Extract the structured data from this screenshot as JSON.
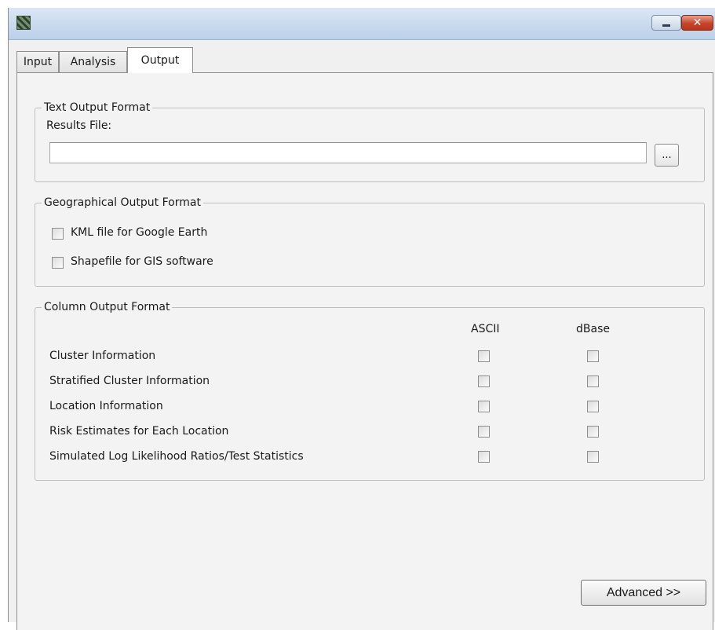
{
  "window": {
    "app_icon": "satscan-app-icon",
    "minimize_icon": "minimize-icon",
    "close_icon": "close-icon",
    "close_glyph": "✕"
  },
  "tabs": [
    {
      "label": "Input",
      "active": false
    },
    {
      "label": "Analysis",
      "active": false
    },
    {
      "label": "Output",
      "active": true
    }
  ],
  "text_output": {
    "title": "Text Output Format",
    "results_label": "Results File:",
    "results_value": "",
    "browse_label": "..."
  },
  "geo_output": {
    "title": "Geographical Output Format",
    "options": [
      {
        "label": "KML file for Google Earth",
        "checked": false
      },
      {
        "label": "Shapefile for GIS software",
        "checked": false
      }
    ]
  },
  "column_output": {
    "title": "Column Output Format",
    "col_ascii": "ASCII",
    "col_dbase": "dBase",
    "rows": [
      {
        "label": "Cluster Information",
        "ascii": false,
        "dbase": false
      },
      {
        "label": "Stratified Cluster Information",
        "ascii": false,
        "dbase": false
      },
      {
        "label": "Location Information",
        "ascii": false,
        "dbase": false
      },
      {
        "label": "Risk Estimates for Each Location",
        "ascii": false,
        "dbase": false
      },
      {
        "label": "Simulated Log Likelihood Ratios/Test Statistics",
        "ascii": false,
        "dbase": false
      }
    ]
  },
  "advanced_label": "Advanced >>"
}
